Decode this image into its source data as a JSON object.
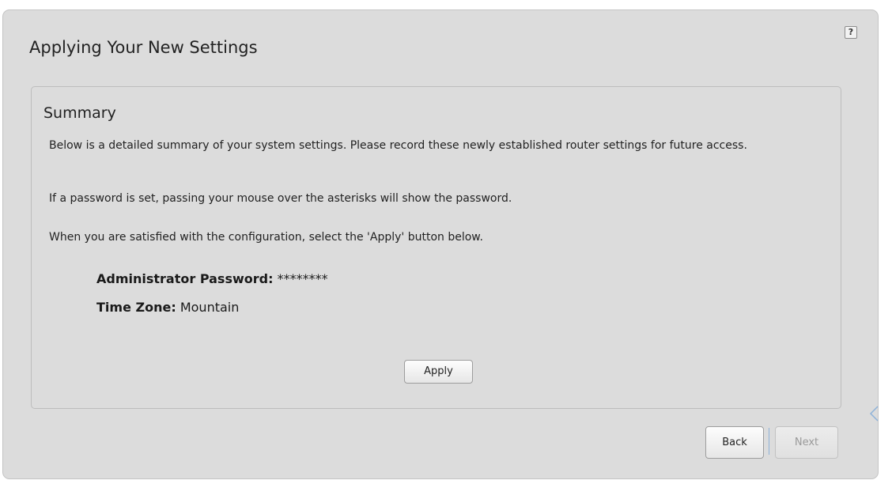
{
  "page": {
    "title": "Applying Your New Settings",
    "help_icon": "?"
  },
  "summary": {
    "heading": "Summary",
    "paragraph1": "Below is a detailed summary of your system settings. Please record these newly established router settings for future access.",
    "paragraph2": "If a password is set, passing your mouse over the asterisks will show the password.",
    "paragraph3": "When you are satisfied with the configuration, select the 'Apply' button below.",
    "settings": {
      "password_label": "Administrator Password:",
      "password_value": "********",
      "timezone_label": "Time Zone:",
      "timezone_value": "Mountain"
    },
    "apply_label": "Apply"
  },
  "nav": {
    "back_label": "Back",
    "next_label": "Next"
  },
  "icons": {
    "help": "help-icon",
    "side": "chevron-left-icon"
  },
  "colors": {
    "panel_bg": "#dcdcdc",
    "divider_accent": "#8fb3d9",
    "disabled_text": "#9a9a9a"
  }
}
